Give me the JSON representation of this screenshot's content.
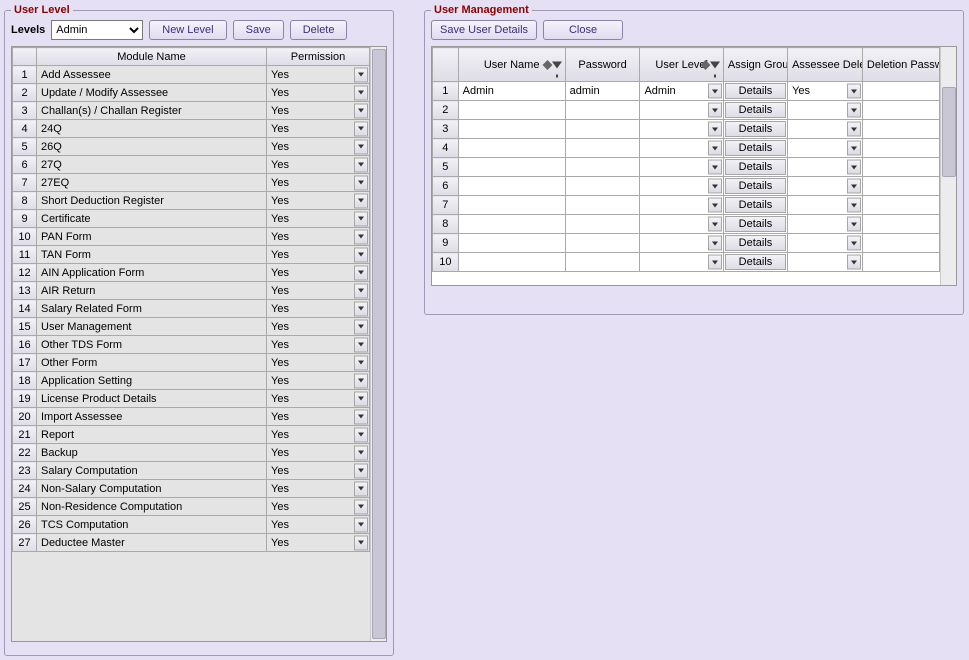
{
  "user_level": {
    "legend": "User Level",
    "levels_label": "Levels",
    "levels_value": "Admin",
    "buttons": {
      "new_level": "New Level",
      "save": "Save",
      "delete": "Delete"
    },
    "columns": {
      "module": "Module Name",
      "permission": "Permission"
    },
    "rows": [
      {
        "n": "1",
        "module": "Add Assessee",
        "perm": "Yes"
      },
      {
        "n": "2",
        "module": "Update / Modify Assessee",
        "perm": "Yes"
      },
      {
        "n": "3",
        "module": "Challan(s) / Challan Register",
        "perm": "Yes"
      },
      {
        "n": "4",
        "module": "24Q",
        "perm": "Yes"
      },
      {
        "n": "5",
        "module": "26Q",
        "perm": "Yes"
      },
      {
        "n": "6",
        "module": "27Q",
        "perm": "Yes"
      },
      {
        "n": "7",
        "module": "27EQ",
        "perm": "Yes"
      },
      {
        "n": "8",
        "module": "Short Deduction Register",
        "perm": "Yes"
      },
      {
        "n": "9",
        "module": "Certificate",
        "perm": "Yes"
      },
      {
        "n": "10",
        "module": "PAN Form",
        "perm": "Yes"
      },
      {
        "n": "11",
        "module": "TAN Form",
        "perm": "Yes"
      },
      {
        "n": "12",
        "module": "AIN Application Form",
        "perm": "Yes"
      },
      {
        "n": "13",
        "module": "AIR Return",
        "perm": "Yes"
      },
      {
        "n": "14",
        "module": "Salary Related Form",
        "perm": "Yes"
      },
      {
        "n": "15",
        "module": "User Management",
        "perm": "Yes"
      },
      {
        "n": "16",
        "module": "Other TDS Form",
        "perm": "Yes"
      },
      {
        "n": "17",
        "module": "Other Form",
        "perm": "Yes"
      },
      {
        "n": "18",
        "module": "Application Setting",
        "perm": "Yes"
      },
      {
        "n": "19",
        "module": "License Product Details",
        "perm": "Yes"
      },
      {
        "n": "20",
        "module": "Import Assessee",
        "perm": "Yes"
      },
      {
        "n": "21",
        "module": "Report",
        "perm": "Yes"
      },
      {
        "n": "22",
        "module": "Backup",
        "perm": "Yes"
      },
      {
        "n": "23",
        "module": "Salary Computation",
        "perm": "Yes"
      },
      {
        "n": "24",
        "module": "Non-Salary Computation",
        "perm": "Yes"
      },
      {
        "n": "25",
        "module": "Non-Residence Computation",
        "perm": "Yes"
      },
      {
        "n": "26",
        "module": "TCS Computation",
        "perm": "Yes"
      },
      {
        "n": "27",
        "module": "Deductee Master",
        "perm": "Yes"
      }
    ]
  },
  "user_mgmt": {
    "legend": "User Management",
    "buttons": {
      "save": "Save User Details",
      "close": "Close"
    },
    "columns": {
      "user_name": "User Name",
      "password": "Password",
      "user_level": "User Level",
      "assign_group": "Assign Group",
      "assessee_deletion": "Assessee Deletion",
      "deletion_password": "Deletion Password"
    },
    "details_label": "Details",
    "rows": [
      {
        "n": "1",
        "user_name": "Admin",
        "password": "admin",
        "user_level": "Admin",
        "assessee_deletion": "Yes",
        "deletion_password": ""
      },
      {
        "n": "2",
        "user_name": "",
        "password": "",
        "user_level": "",
        "assessee_deletion": "",
        "deletion_password": ""
      },
      {
        "n": "3",
        "user_name": "",
        "password": "",
        "user_level": "",
        "assessee_deletion": "",
        "deletion_password": ""
      },
      {
        "n": "4",
        "user_name": "",
        "password": "",
        "user_level": "",
        "assessee_deletion": "",
        "deletion_password": ""
      },
      {
        "n": "5",
        "user_name": "",
        "password": "",
        "user_level": "",
        "assessee_deletion": "",
        "deletion_password": ""
      },
      {
        "n": "6",
        "user_name": "",
        "password": "",
        "user_level": "",
        "assessee_deletion": "",
        "deletion_password": ""
      },
      {
        "n": "7",
        "user_name": "",
        "password": "",
        "user_level": "",
        "assessee_deletion": "",
        "deletion_password": ""
      },
      {
        "n": "8",
        "user_name": "",
        "password": "",
        "user_level": "",
        "assessee_deletion": "",
        "deletion_password": ""
      },
      {
        "n": "9",
        "user_name": "",
        "password": "",
        "user_level": "",
        "assessee_deletion": "",
        "deletion_password": ""
      },
      {
        "n": "10",
        "user_name": "",
        "password": "",
        "user_level": "",
        "assessee_deletion": "",
        "deletion_password": ""
      }
    ]
  }
}
